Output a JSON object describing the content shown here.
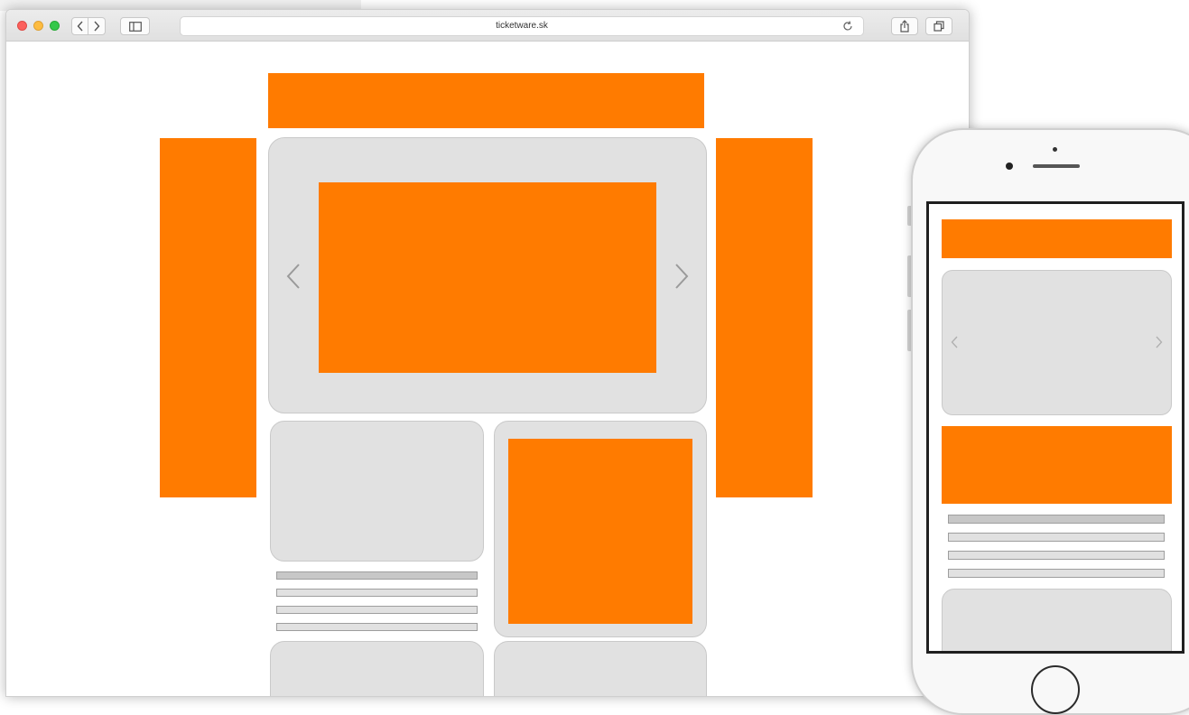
{
  "browser": {
    "url": "ticketware.sk",
    "nav_back_icon": "chevron-left-icon",
    "nav_forward_icon": "chevron-right-icon",
    "sidebar_icon": "sidebar-icon",
    "reload_icon": "reload-icon",
    "share_icon": "share-icon",
    "tabs_icon": "tabs-icon"
  },
  "colors": {
    "accent": "#ff7b00",
    "placeholder": "#e1e1e1",
    "window_close": "#fc605c",
    "window_minimize": "#fdbc40",
    "window_zoom": "#34c84a"
  },
  "wireframe": {
    "carousel_prev_icon": "chevron-left-icon",
    "carousel_next_icon": "chevron-right-icon"
  }
}
